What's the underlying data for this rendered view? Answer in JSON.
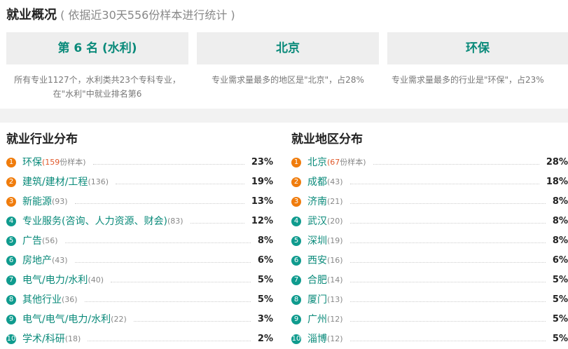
{
  "header": {
    "title": "就业概况",
    "subtitle": "( 依据近30天556份样本进行统计 )"
  },
  "summary_cards": [
    {
      "title": "第 6 名 (水利)",
      "desc": "所有专业1127个，水利类共23个专科专业，在\"水利\"中就业排名第6"
    },
    {
      "title": "北京",
      "desc": "专业需求量最多的地区是\"北京\"，占28%"
    },
    {
      "title": "环保",
      "desc": "专业需求量最多的行业是\"环保\"，占23%"
    }
  ],
  "industry": {
    "title": "就业行业分布",
    "items": [
      {
        "rank": "1",
        "name": "环保",
        "count": "159",
        "count_suffix": "份样本",
        "pct": "23%"
      },
      {
        "rank": "2",
        "name": "建筑/建材/工程",
        "count": "(136)",
        "pct": "19%"
      },
      {
        "rank": "3",
        "name": "新能源",
        "count": "(93)",
        "pct": "13%"
      },
      {
        "rank": "4",
        "name": "专业服务(咨询、人力资源、财会)",
        "count": "(83)",
        "pct": "12%"
      },
      {
        "rank": "5",
        "name": "广告",
        "count": "(56)",
        "pct": "8%"
      },
      {
        "rank": "6",
        "name": "房地产",
        "count": "(43)",
        "pct": "6%"
      },
      {
        "rank": "7",
        "name": "电气/电力/水利",
        "count": "(40)",
        "pct": "5%"
      },
      {
        "rank": "8",
        "name": "其他行业",
        "count": "(36)",
        "pct": "5%"
      },
      {
        "rank": "9",
        "name": "电气/电气/电力/水利",
        "count": "(22)",
        "pct": "3%"
      },
      {
        "rank": "10",
        "name": "学术/科研",
        "count": "(18)",
        "pct": "2%"
      }
    ]
  },
  "region": {
    "title": "就业地区分布",
    "items": [
      {
        "rank": "1",
        "name": "北京",
        "count": "67",
        "count_suffix": "份样本",
        "pct": "28%"
      },
      {
        "rank": "2",
        "name": "成都",
        "count": "(43)",
        "pct": "18%"
      },
      {
        "rank": "3",
        "name": "济南",
        "count": "(21)",
        "pct": "8%"
      },
      {
        "rank": "4",
        "name": "武汉",
        "count": "(20)",
        "pct": "8%"
      },
      {
        "rank": "5",
        "name": "深圳",
        "count": "(19)",
        "pct": "8%"
      },
      {
        "rank": "6",
        "name": "西安",
        "count": "(16)",
        "pct": "6%"
      },
      {
        "rank": "7",
        "name": "合肥",
        "count": "(14)",
        "pct": "5%"
      },
      {
        "rank": "8",
        "name": "厦门",
        "count": "(13)",
        "pct": "5%"
      },
      {
        "rank": "9",
        "name": "广州",
        "count": "(12)",
        "pct": "5%"
      },
      {
        "rank": "10",
        "name": "淄博",
        "count": "(12)",
        "pct": "5%"
      }
    ]
  },
  "colors": {
    "accent_teal": "#0a8a7a",
    "rank_top": "#f07c0c",
    "rank_other": "#0f9b8e"
  }
}
